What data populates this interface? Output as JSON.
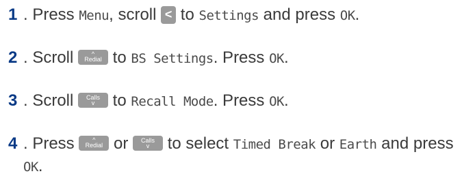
{
  "steps": [
    {
      "number": "1",
      "parts": [
        {
          "t": "text",
          "v": ". Press "
        },
        {
          "t": "lcd",
          "v": "Menu"
        },
        {
          "t": "text",
          "v": ", scroll "
        },
        {
          "t": "key",
          "icon": "left-chevron-key",
          "label": "<"
        },
        {
          "t": "text",
          "v": " to "
        },
        {
          "t": "lcd",
          "v": "Settings"
        },
        {
          "t": "text",
          "v": " and press "
        },
        {
          "t": "lcd",
          "v": "OK"
        },
        {
          "t": "text",
          "v": "."
        }
      ]
    },
    {
      "number": "2",
      "parts": [
        {
          "t": "text",
          "v": ". Scroll "
        },
        {
          "t": "key",
          "icon": "redial-up-key",
          "label": "Redial",
          "arrow": "^"
        },
        {
          "t": "text",
          "v": " to "
        },
        {
          "t": "lcd",
          "v": "BS Settings"
        },
        {
          "t": "text",
          "v": ". Press "
        },
        {
          "t": "lcd",
          "v": "OK"
        },
        {
          "t": "text",
          "v": "."
        }
      ]
    },
    {
      "number": "3",
      "parts": [
        {
          "t": "text",
          "v": ". Scroll "
        },
        {
          "t": "key",
          "icon": "calls-down-key",
          "label": "Calls",
          "arrow": "v"
        },
        {
          "t": "text",
          "v": " to "
        },
        {
          "t": "lcd",
          "v": "Recall Mode"
        },
        {
          "t": "text",
          "v": ". Press "
        },
        {
          "t": "lcd",
          "v": "OK"
        },
        {
          "t": "text",
          "v": "."
        }
      ]
    },
    {
      "number": "4",
      "parts": [
        {
          "t": "text",
          "v": ". Press "
        },
        {
          "t": "key",
          "icon": "redial-up-key",
          "label": "Redial",
          "arrow": "^"
        },
        {
          "t": "text",
          "v": " or "
        },
        {
          "t": "key",
          "icon": "calls-down-key",
          "label": "Calls",
          "arrow": "v"
        },
        {
          "t": "text",
          "v": " to select "
        },
        {
          "t": "lcd",
          "v": "Timed Break"
        },
        {
          "t": "text",
          "v": " or "
        },
        {
          "t": "lcd",
          "v": "Earth"
        },
        {
          "t": "text",
          "v": " and press "
        },
        {
          "t": "lcd",
          "v": "OK"
        },
        {
          "t": "text",
          "v": "."
        }
      ]
    }
  ]
}
